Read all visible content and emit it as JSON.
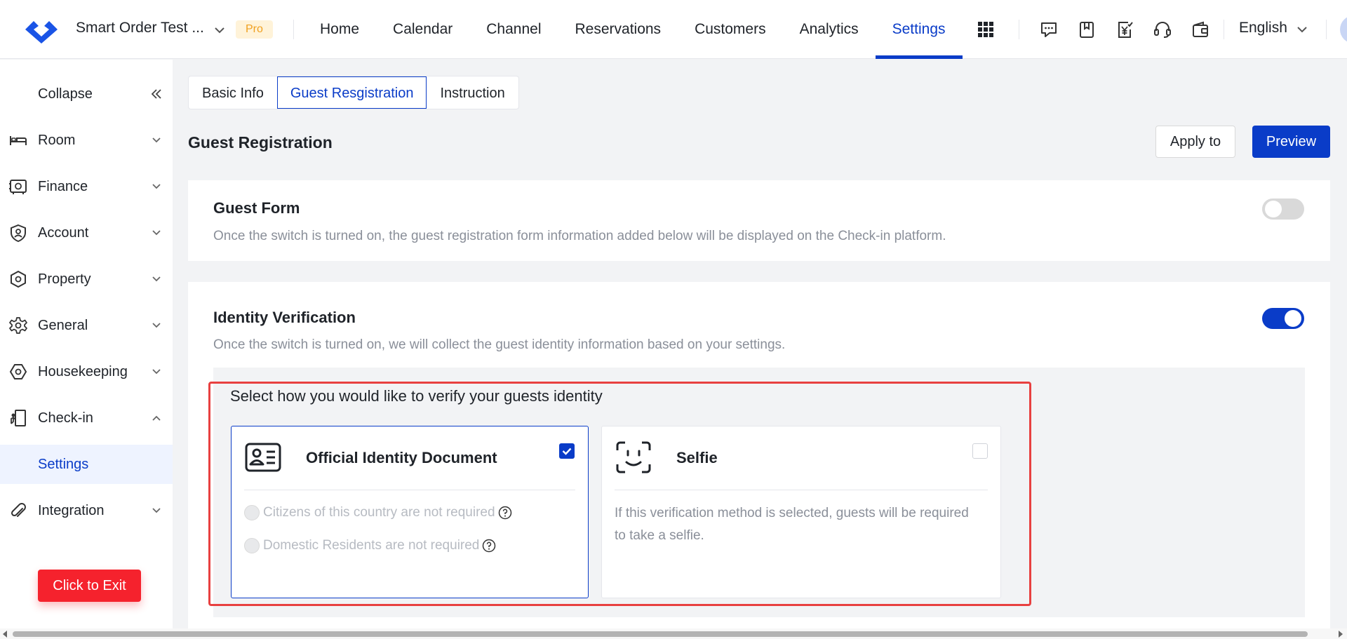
{
  "topbar": {
    "brand": "Smart Order Test ...",
    "badge": "Pro",
    "nav": [
      {
        "label": "Home"
      },
      {
        "label": "Calendar"
      },
      {
        "label": "Channel"
      },
      {
        "label": "Reservations"
      },
      {
        "label": "Customers"
      },
      {
        "label": "Analytics"
      },
      {
        "label": "Settings",
        "active": true
      }
    ],
    "language": "English",
    "icons": [
      "apps-grid-icon",
      "feedback-chat-icon",
      "bookmark-icon",
      "invoice-yen-icon",
      "headset-support-icon",
      "wallet-icon"
    ]
  },
  "sidebar": {
    "collapse_label": "Collapse",
    "items": [
      {
        "label": "Room",
        "icon": "bed-icon"
      },
      {
        "label": "Finance",
        "icon": "safe-icon"
      },
      {
        "label": "Account",
        "icon": "user-shield-icon"
      },
      {
        "label": "Property",
        "icon": "property-hexagon-icon"
      },
      {
        "label": "General",
        "icon": "gear-icon"
      },
      {
        "label": "Housekeeping",
        "icon": "housekeeping-hexagon-icon"
      },
      {
        "label": "Check-in",
        "icon": "checkin-door-icon",
        "expanded": true
      },
      {
        "label": "Settings",
        "selected": true
      },
      {
        "label": "Integration",
        "icon": "paperclip-icon"
      }
    ],
    "exit_label": "Click to Exit"
  },
  "tabs": [
    {
      "label": "Basic Info"
    },
    {
      "label": "Guest Resgistration",
      "active": true
    },
    {
      "label": "Instruction"
    }
  ],
  "page": {
    "title": "Guest Registration",
    "apply_label": "Apply to",
    "preview_label": "Preview"
  },
  "guest_form": {
    "title": "Guest Form",
    "description": "Once the switch is turned on, the guest registration form information added below will be displayed on the Check-in platform.",
    "enabled": false
  },
  "identity": {
    "title": "Identity Verification",
    "description": "Once the switch is turned on, we will collect the guest identity information based on your settings.",
    "enabled": true,
    "prompt": "Select how you would like to verify your guests identity",
    "options": [
      {
        "title": "Official Identity Document",
        "checked": true,
        "radios": [
          "Citizens of this country are not required",
          "Domestic Residents are not required"
        ]
      },
      {
        "title": "Selfie",
        "checked": false,
        "description": "If this verification method is selected, guests will be required to take a selfie."
      }
    ]
  },
  "colors": {
    "primary": "#0a3cc8",
    "danger": "#f5222d",
    "highlight_border": "#e84040",
    "pro_badge": "#f0a020"
  }
}
